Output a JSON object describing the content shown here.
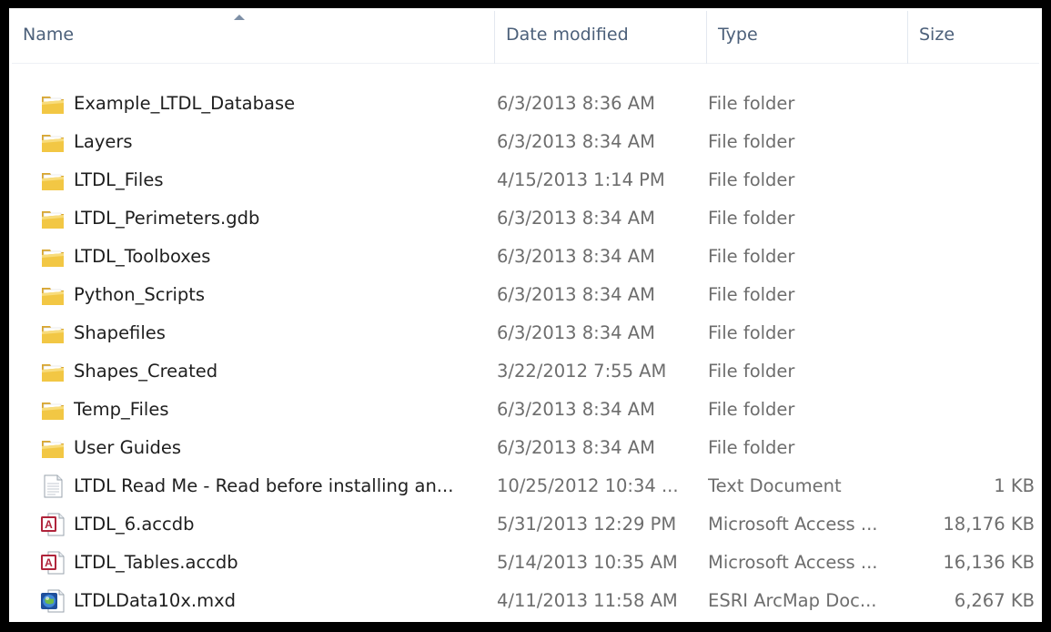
{
  "columns": {
    "name": "Name",
    "date": "Date modified",
    "type": "Type",
    "size": "Size"
  },
  "files": [
    {
      "icon": "folder-icon",
      "name": "Example_LTDL_Database",
      "date": "6/3/2013 8:36 AM",
      "type": "File folder",
      "size": ""
    },
    {
      "icon": "folder-icon",
      "name": "Layers",
      "date": "6/3/2013 8:34 AM",
      "type": "File folder",
      "size": ""
    },
    {
      "icon": "folder-icon",
      "name": "LTDL_Files",
      "date": "4/15/2013 1:14 PM",
      "type": "File folder",
      "size": ""
    },
    {
      "icon": "folder-icon",
      "name": "LTDL_Perimeters.gdb",
      "date": "6/3/2013 8:34 AM",
      "type": "File folder",
      "size": ""
    },
    {
      "icon": "folder-icon",
      "name": "LTDL_Toolboxes",
      "date": "6/3/2013 8:34 AM",
      "type": "File folder",
      "size": ""
    },
    {
      "icon": "folder-icon",
      "name": "Python_Scripts",
      "date": "6/3/2013 8:34 AM",
      "type": "File folder",
      "size": ""
    },
    {
      "icon": "folder-icon",
      "name": "Shapefiles",
      "date": "6/3/2013 8:34 AM",
      "type": "File folder",
      "size": ""
    },
    {
      "icon": "folder-icon",
      "name": "Shapes_Created",
      "date": "3/22/2012 7:55 AM",
      "type": "File folder",
      "size": ""
    },
    {
      "icon": "folder-icon",
      "name": "Temp_Files",
      "date": "6/3/2013 8:34 AM",
      "type": "File folder",
      "size": ""
    },
    {
      "icon": "folder-icon",
      "name": "User Guides",
      "date": "6/3/2013 8:34 AM",
      "type": "File folder",
      "size": ""
    },
    {
      "icon": "text-document-icon",
      "name": "LTDL Read Me - Read before installing an...",
      "date": "10/25/2012 10:34 ...",
      "type": "Text Document",
      "size": "1 KB"
    },
    {
      "icon": "access-database-icon",
      "name": "LTDL_6.accdb",
      "date": "5/31/2013 12:29 PM",
      "type": "Microsoft Access ...",
      "size": "18,176 KB"
    },
    {
      "icon": "access-database-icon",
      "name": "LTDL_Tables.accdb",
      "date": "5/14/2013 10:35 AM",
      "type": "Microsoft Access ...",
      "size": "16,136 KB"
    },
    {
      "icon": "arcmap-document-icon",
      "name": "LTDLData10x.mxd",
      "date": "4/11/2013 11:58 AM",
      "type": "ESRI ArcMap Doc...",
      "size": "6,267 KB"
    }
  ],
  "colors": {
    "header_text": "#4c607a",
    "folder_yellow": "#f2c744",
    "access_red": "#b0243b",
    "arcmap_blue": "#2463b8"
  }
}
